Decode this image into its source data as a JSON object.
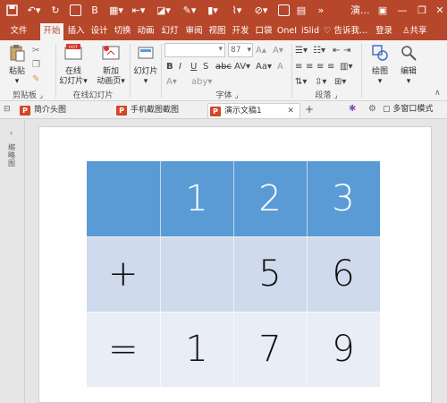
{
  "window": {
    "title": "演...",
    "colors": {
      "accent": "#b7472a",
      "ribbon_bg": "#f3f3f3",
      "table_header": "#5b9bd5",
      "table_row1": "#cfdbec",
      "table_row2": "#e8edf6"
    }
  },
  "quick_access": [
    "save-icon",
    "undo-icon",
    "redo-icon",
    "start-from-beginning-icon"
  ],
  "ribbon_tabs": [
    "文件",
    "开始",
    "插入",
    "设计",
    "切换",
    "动画",
    "幻灯片",
    "审阅",
    "视图",
    "开发",
    "口袋",
    "OneI",
    "iSlid"
  ],
  "active_tab": "开始",
  "tell_me": "告诉我...",
  "login": "登录",
  "share": "共享",
  "ribbon": {
    "paste": "粘贴",
    "clipboard": "剪贴板",
    "online_slide_1": "在线",
    "online_slide_2": "幻灯片",
    "new_anim_1": "新加",
    "new_anim_2": "动画页",
    "online_group": "在线幻灯片",
    "slides_btn": "幻灯片",
    "font_size": "87",
    "font_group": "字体",
    "paragraph_group": "段落",
    "draw": "绘图",
    "edit": "编辑"
  },
  "doc_tabs": [
    {
      "label": "简介头图"
    },
    {
      "label": "手机截图截图"
    },
    {
      "label": "演示文稿1"
    }
  ],
  "multi_window": "多窗口模式",
  "left_pane_label": "缩略图",
  "table": {
    "rows": [
      [
        "",
        "1",
        "2",
        "3"
      ],
      [
        "+",
        "",
        "5",
        "6"
      ],
      [
        "=",
        "1",
        "7",
        "9"
      ]
    ]
  }
}
